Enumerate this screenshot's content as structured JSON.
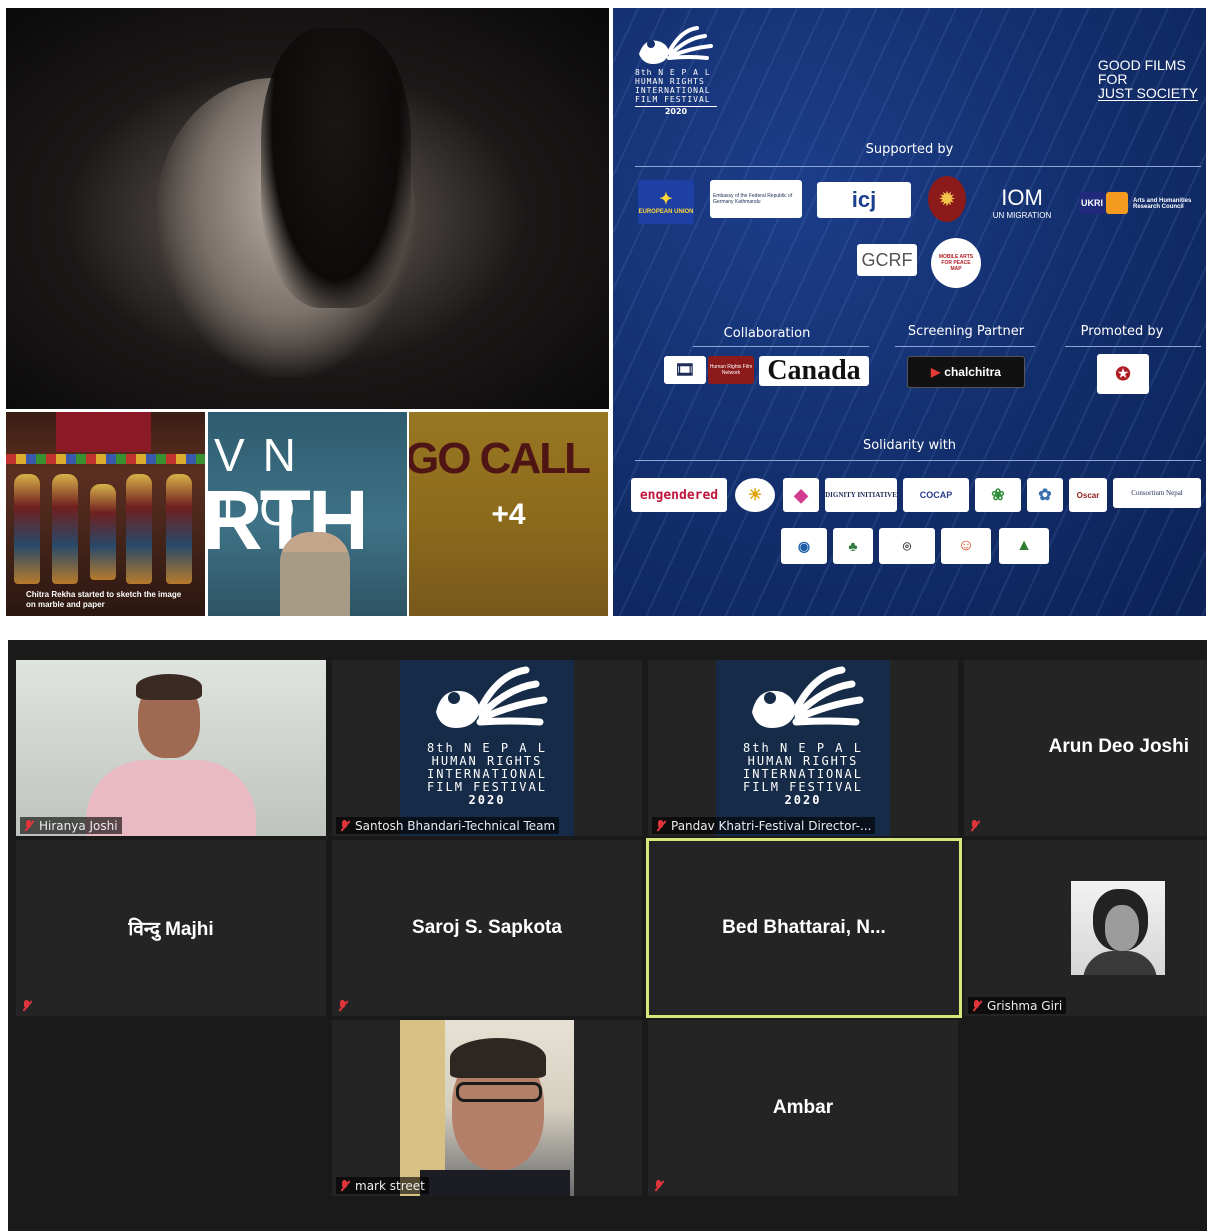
{
  "collage": {
    "thumb1_caption": "Chitra Rekha started to sketch the image on marble and paper",
    "thumb2_line1": "VN TO",
    "thumb2_line2": "RTH",
    "thumb3_text": "GO CALL",
    "more_count": "+4"
  },
  "poster": {
    "festival_edition": "8th",
    "festival_title_lines": [
      "N E P A L",
      "HUMAN RIGHTS",
      "INTERNATIONAL",
      "FILM FESTIVAL"
    ],
    "festival_year": "2020",
    "tagline": [
      "GOOD FILMS",
      "FOR",
      "JUST SOCIETY"
    ],
    "supported_by": "Supported by",
    "collaboration": "Collaboration",
    "screening_partner": "Screening Partner",
    "promoted_by": "Promoted by",
    "solidarity_with": "Solidarity with",
    "logos": {
      "eu": "EUROPEAN UNION",
      "germany": "Embassy of the Federal Republic of Germany Kathmandu",
      "icj": "icj",
      "iom": "IOM",
      "iom_sub": "UN MIGRATION",
      "ukri": "UKRI",
      "ahrc": "Arts and Humanities Research Council",
      "gcrf": "GCRF",
      "mobile_arts": "MOBILE ARTS FOR PEACE MAP",
      "hrfn": "Human Rights Film Network",
      "canada": "Canada",
      "chalchitra": "chalchitra",
      "engendered": "engendered",
      "dignity": "DIGNITY INITIATIVE",
      "cocap": "COCAP",
      "oscar": "Oscar",
      "consortium": "Consortium Nepal"
    }
  },
  "meeting": {
    "participants": [
      {
        "name": "Hiranya Joshi"
      },
      {
        "name": "Santosh Bhandari-Technical Team"
      },
      {
        "name": "Pandav Khatri-Festival Director-..."
      },
      {
        "name": "Arun Deo Joshi"
      },
      {
        "name": "विन्दु Majhi"
      },
      {
        "name": "Saroj S. Sapkota"
      },
      {
        "name": "Bed  Bhattarai, N..."
      },
      {
        "name": "Grishma Giri"
      },
      {
        "name": "mark street"
      },
      {
        "name": "Ambar"
      }
    ],
    "active_speaker_color": "#d8e77a",
    "muted_icon": "mic-muted-icon"
  }
}
